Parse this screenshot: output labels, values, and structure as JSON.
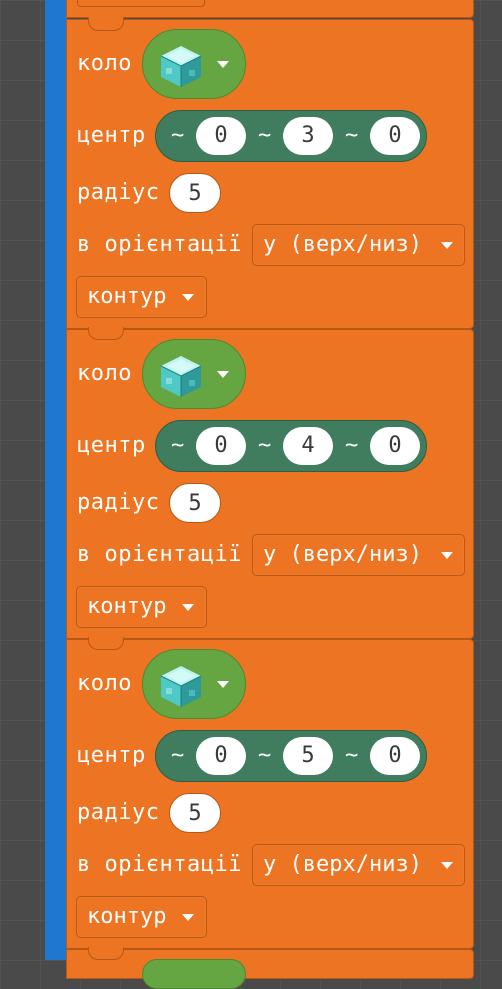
{
  "blocks": [
    {
      "label": "коло",
      "block_icon": "diamond-block-icon",
      "center_label": "центр",
      "center_tilde": "~",
      "center": {
        "x": "0",
        "y": "3",
        "z": "0"
      },
      "radius_label": "радіус",
      "radius": "5",
      "orientation_label": "в орієнтації",
      "orientation": "y (верх/низ)",
      "mode": "контур"
    },
    {
      "label": "коло",
      "block_icon": "diamond-block-icon",
      "center_label": "центр",
      "center_tilde": "~",
      "center": {
        "x": "0",
        "y": "4",
        "z": "0"
      },
      "radius_label": "радіус",
      "radius": "5",
      "orientation_label": "в орієнтації",
      "orientation": "y (верх/низ)",
      "mode": "контур"
    },
    {
      "label": "коло",
      "block_icon": "diamond-block-icon",
      "center_label": "центр",
      "center_tilde": "~",
      "center": {
        "x": "0",
        "y": "5",
        "z": "0"
      },
      "radius_label": "радіус",
      "radius": "5",
      "orientation_label": "в орієнтації",
      "orientation": "y (верх/низ)",
      "mode": "контур"
    }
  ],
  "colors": {
    "block_orange": "#ec7423",
    "block_pill_green": "#66a642",
    "position_pill_green": "#3f7d5e",
    "rail_blue": "#1f77d0",
    "workspace_bg": "#4a4a4a"
  }
}
